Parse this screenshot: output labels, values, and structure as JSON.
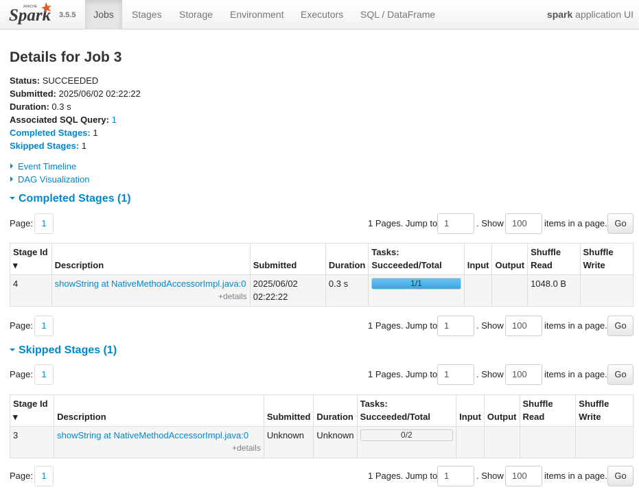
{
  "nav": {
    "brand": "Spark",
    "apache": "APACHE",
    "version": "3.5.5",
    "tabs": [
      "Jobs",
      "Stages",
      "Storage",
      "Environment",
      "Executors",
      "SQL / DataFrame"
    ],
    "app_name_bold": "spark",
    "app_name_rest": " application UI"
  },
  "page": {
    "title": "Details for Job 3",
    "status_label": "Status:",
    "status": "SUCCEEDED",
    "submitted_label": "Submitted:",
    "submitted": "2025/06/02 02:22:22",
    "duration_label": "Duration:",
    "duration": "0.3 s",
    "sql_label": "Associated SQL Query:",
    "sql_id": "1",
    "completed_label": "Completed Stages:",
    "completed_count": "1",
    "skipped_label": "Skipped Stages:",
    "skipped_count": "1",
    "event_timeline": "Event Timeline",
    "dag_visualization": "DAG Visualization"
  },
  "pager": {
    "page_label": "Page:",
    "page_num": "1",
    "pages_text": "1 Pages. Jump to",
    "jump_value": "1",
    "show_text": ". Show",
    "show_value": "100",
    "items_text": "items in a page.",
    "go": "Go"
  },
  "completed": {
    "heading": "Completed Stages (1)",
    "headers": {
      "stage_id": "Stage Id ▾",
      "description": "Description",
      "submitted": "Submitted",
      "duration": "Duration",
      "tasks": "Tasks: Succeeded/Total",
      "input": "Input",
      "output": "Output",
      "shuffle_read": "Shuffle Read",
      "shuffle_write": "Shuffle Write"
    },
    "row": {
      "stage_id": "4",
      "description": "showString at NativeMethodAccessorImpl.java:0",
      "details": "+details",
      "submitted": "2025/06/02 02:22:22",
      "duration": "0.3 s",
      "tasks": "1/1",
      "tasks_fraction": 1.0,
      "input": "",
      "output": "",
      "shuffle_read": "1048.0 B",
      "shuffle_write": ""
    }
  },
  "skipped": {
    "heading": "Skipped Stages (1)",
    "headers": {
      "stage_id": "Stage Id ▾",
      "description": "Description",
      "submitted": "Submitted",
      "duration": "Duration",
      "tasks": "Tasks: Succeeded/Total",
      "input": "Input",
      "output": "Output",
      "shuffle_read": "Shuffle Read",
      "shuffle_write": "Shuffle Write"
    },
    "row": {
      "stage_id": "3",
      "description": "showString at NativeMethodAccessorImpl.java:0",
      "details": "+details",
      "submitted": "Unknown",
      "duration": "Unknown",
      "tasks": "0/2",
      "tasks_fraction": 0.0,
      "input": "",
      "output": "",
      "shuffle_read": "",
      "shuffle_write": ""
    }
  },
  "colors": {
    "link": "#0088cc",
    "progress": "#40a6e0",
    "logo_orange": "#e25a1c"
  }
}
